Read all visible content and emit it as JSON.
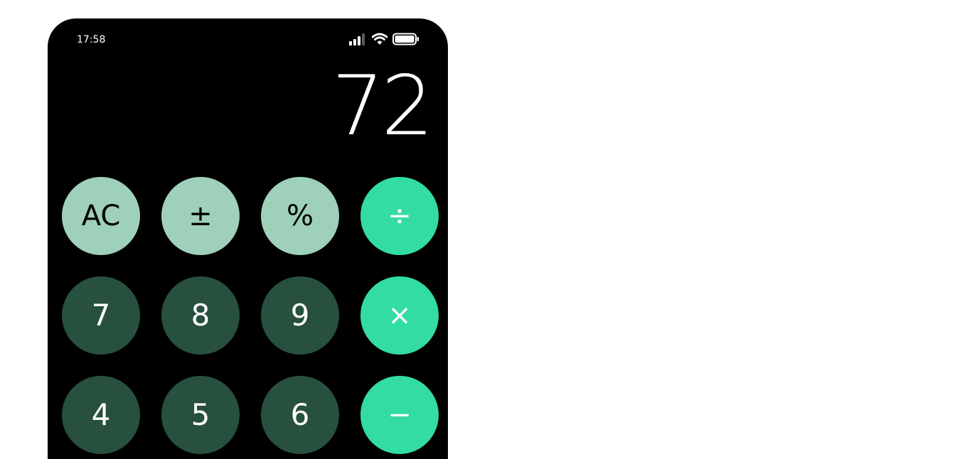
{
  "status_bar": {
    "time": "17:58",
    "icons": [
      "signal-icon",
      "wifi-icon",
      "battery-icon"
    ]
  },
  "display": {
    "value": "72"
  },
  "keys": {
    "row1": [
      "AC",
      "±",
      "%",
      "÷"
    ],
    "row2": [
      "7",
      "8",
      "9",
      "×"
    ],
    "row3": [
      "4",
      "5",
      "6",
      "−"
    ]
  },
  "colors": {
    "function_key": "#9fd0ba",
    "operator_key": "#33dba5",
    "number_key": "#27503e",
    "background": "#000000"
  }
}
